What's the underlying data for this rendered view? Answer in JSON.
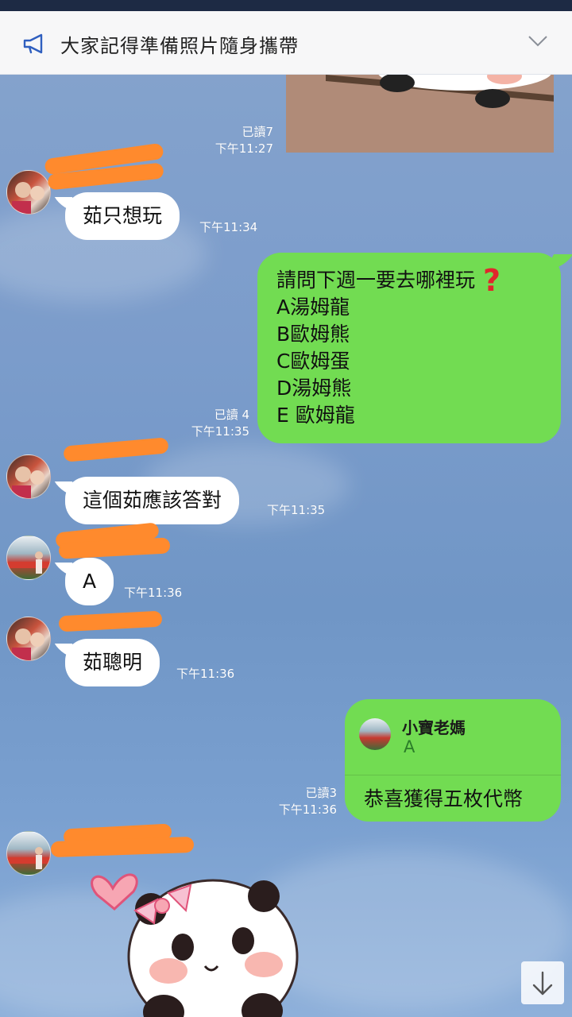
{
  "announcement": {
    "text": "大家記得準備照片隨身攜帶",
    "megaphone_icon": "megaphone-icon",
    "expand_icon": "chevron-down-icon"
  },
  "messages": {
    "m0": {
      "read": "已讀7",
      "time": "下午11:27"
    },
    "m1": {
      "text": "茹只想玩",
      "time": "下午11:34"
    },
    "m2": {
      "lines": [
        "請問下週一要去哪裡玩",
        "A湯姆龍",
        "B歐姆熊",
        "C歐姆蛋",
        "D湯姆熊",
        "E 歐姆龍"
      ],
      "read": "已讀 4",
      "time": "下午11:35"
    },
    "m3": {
      "text": "這個茹應該答對",
      "time": "下午11:35"
    },
    "m4": {
      "text": "A",
      "time": "下午11:36"
    },
    "m5": {
      "text": "茹聰明",
      "time": "下午11:36"
    },
    "m6": {
      "reply_name": "小寶老媽",
      "reply_quote": "A",
      "text": "恭喜獲得五枚代幣",
      "read": "已讀3",
      "time": "下午11:36"
    }
  },
  "colors": {
    "bubble_me": "#72dc52",
    "bubble_other": "#ffffff",
    "redaction": "#ff8a2d",
    "background": "#7a9dcc"
  },
  "icons": {
    "scroll_down": "arrow-down-icon",
    "question_mark": "red-question-mark-icon"
  }
}
